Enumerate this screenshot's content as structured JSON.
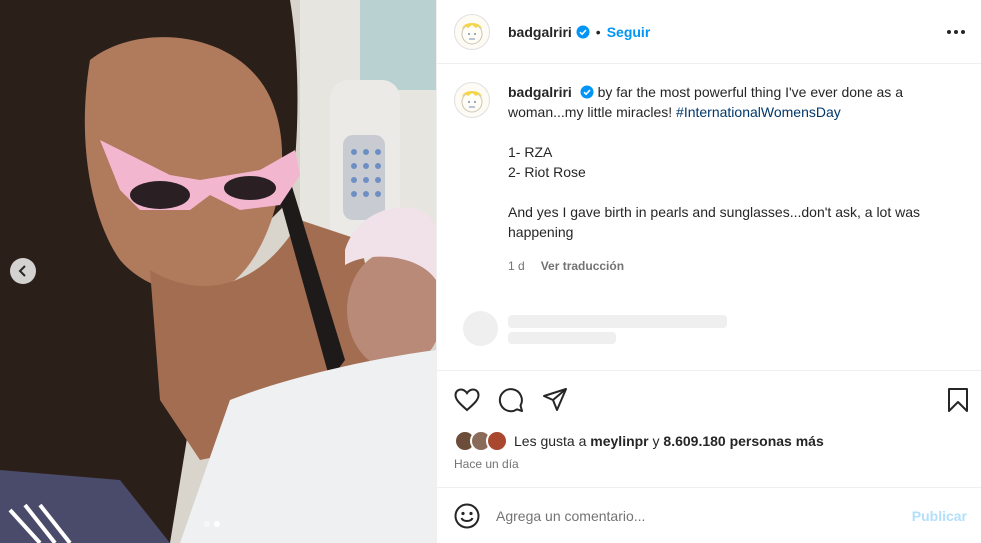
{
  "post": {
    "username": "badgalriri",
    "separator": "•",
    "follow_label": "Seguir",
    "caption_text": "by far the most powerful thing I've ever done as a woman...my little miracles!",
    "hashtag": "#InternationalWomensDay",
    "list_1": "1- RZA",
    "list_2": "2- Riot Rose",
    "caption_extra": "And yes I gave birth in pearls and sunglasses...don't ask, a lot was happening",
    "age": "1 d",
    "translate_label": "Ver traducción"
  },
  "likes": {
    "prefix": "Les gusta a",
    "user": "meylinpr",
    "connector": "y",
    "count": "8.609.180 personas más"
  },
  "timestamp": "Hace un día",
  "comment": {
    "placeholder": "Agrega un comentario...",
    "publish_label": "Publicar"
  },
  "carousel": {
    "total": 2,
    "active": 2
  },
  "colors": {
    "accent": "#0095f6",
    "verified": "#0095f6",
    "hashtag": "#00376b",
    "muted": "#737373",
    "publish_disabled": "#b2dffc"
  },
  "icons": [
    "verified-badge-icon",
    "more-options-icon",
    "heart-icon",
    "comment-icon",
    "share-icon",
    "bookmark-icon",
    "emoji-icon",
    "chevron-left-icon"
  ]
}
